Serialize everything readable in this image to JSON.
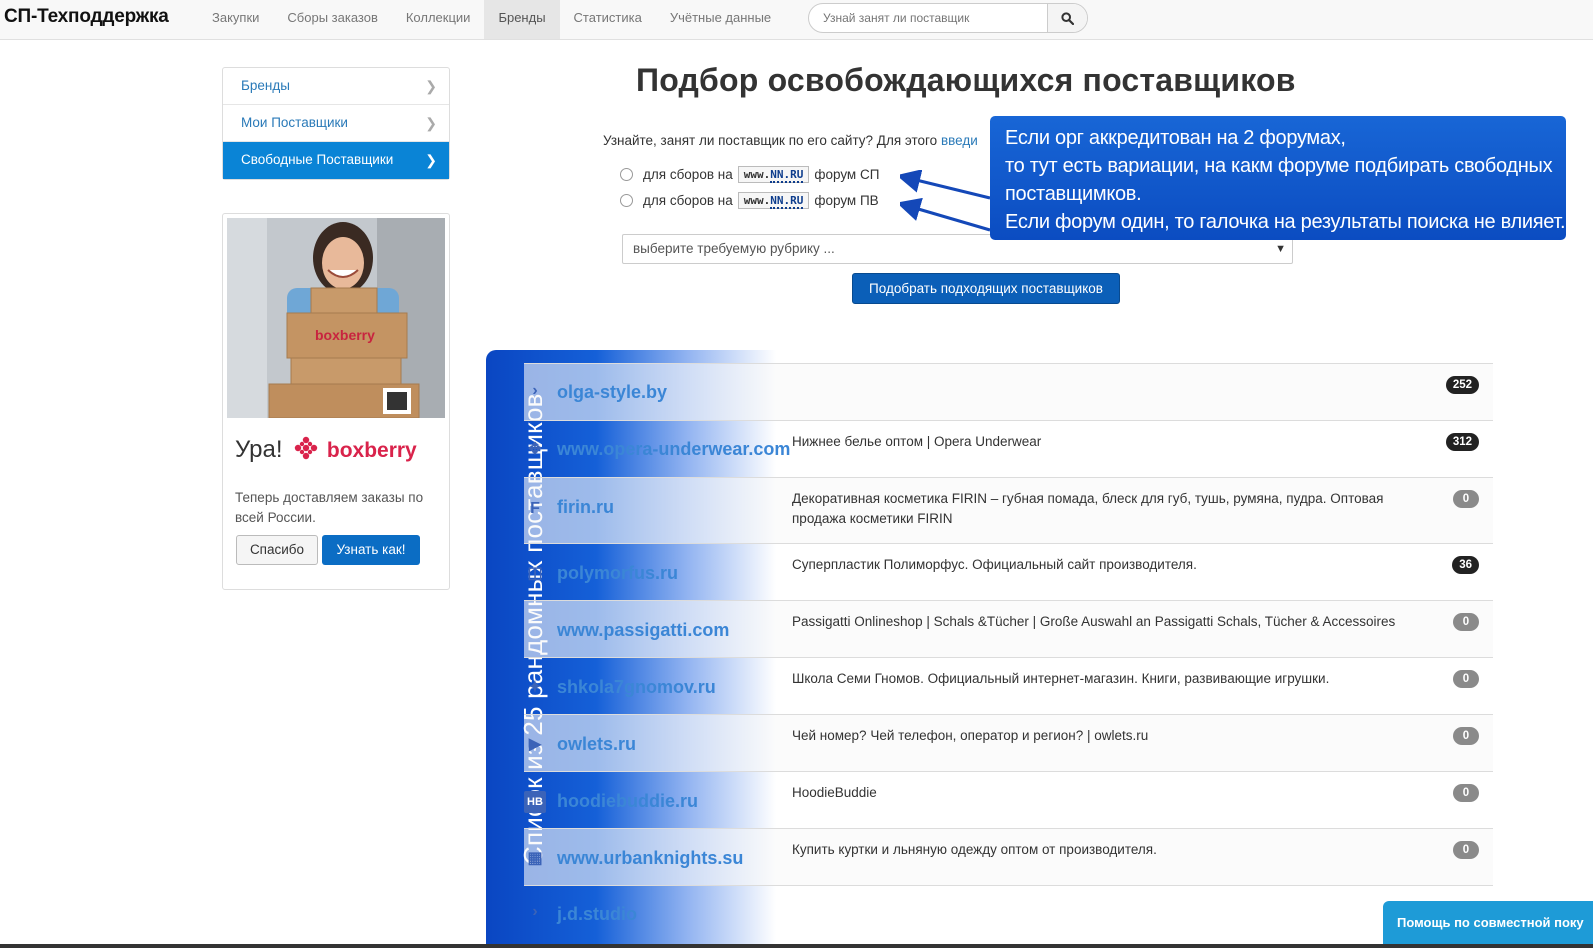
{
  "navbar": {
    "brand": "СП-Техподдержка",
    "items": [
      {
        "label": "Закупки"
      },
      {
        "label": "Сборы заказов"
      },
      {
        "label": "Коллекции"
      },
      {
        "label": "Бренды",
        "active": true
      },
      {
        "label": "Статистика"
      },
      {
        "label": "Учётные данные"
      }
    ],
    "search_placeholder": "Узнай занят ли поставщик",
    "search_icon": "search-icon"
  },
  "sidebar": {
    "items": [
      {
        "label": "Бренды"
      },
      {
        "label": "Мои Поставщики"
      },
      {
        "label": "Свободные Поставщики",
        "active": true
      }
    ]
  },
  "promo": {
    "title_prefix": "Ура!",
    "brand_name": "boxberry",
    "text": "Теперь доставляем заказы по всей России.",
    "thanks_button": "Спасибо",
    "learn_button": "Узнать как!"
  },
  "main": {
    "title": "Подбор освобождающихся поставщиков",
    "intro": "Узнайте, занят ли поставщик по его сайту? Для этого",
    "intro_link": "введи",
    "options": [
      {
        "prefix": "для сборов на",
        "logo_www": "www.",
        "logo_nn": "NN.RU",
        "suffix": "форум СП"
      },
      {
        "prefix": "для сборов на",
        "logo_www": "www.",
        "logo_nn": "NN.RU",
        "suffix": "форум ПВ"
      }
    ],
    "rubric_placeholder": "выберите требуемую рубрику ...",
    "find_button": "Подобрать подходящих поставщиков"
  },
  "callout": {
    "lines": [
      "Если орг аккредитован на 2 форумах,",
      "то тут есть вариации, на какм форуме подбирать свободных",
      "поставщимков.",
      "Если форум один, то галочка на результаты поиска не влияет."
    ]
  },
  "list": {
    "ribbon_label": "Список из 25 рандомных поставщиков",
    "rows": [
      {
        "icon": "chevron-right-icon",
        "site": "olga-style.by",
        "desc": "",
        "count": "252"
      },
      {
        "icon": "bird-icon",
        "site": "www.opera-underwear.com",
        "desc": "Нижнее белье оптом | Opera Underwear",
        "count": "312"
      },
      {
        "icon": "letter-f-icon",
        "site": "firin.ru",
        "desc": "Декоративная косметика FIRIN – губная помада, блеск для губ, тушь, румяна, пудра. Оптовая продажа косметики FIRIN",
        "count": "0"
      },
      {
        "icon": "cart-icon",
        "site": "polymorfus.ru",
        "desc": "Суперпластик Полиморфус. Официальный сайт производителя.",
        "count": "36"
      },
      {
        "icon": "blank-icon",
        "site": "www.passigatti.com",
        "desc": "Passigatti Onlineshop | Schals &Tücher | Große Auswahl an Passigatti Schals, Tücher & Accessoires",
        "count": "0"
      },
      {
        "icon": "gnome-icon",
        "site": "shkola7gnomov.ru",
        "desc": "Школа Семи Гномов. Официальный интернет-магазин. Книги, развивающие игрушки.",
        "count": "0"
      },
      {
        "icon": "play-icon",
        "site": "owlets.ru",
        "desc": "Чей номер? Чей телефон, оператор и регион? | owlets.ru",
        "count": "0"
      },
      {
        "icon": "hb-icon",
        "site": "hoodiebuddie.ru",
        "desc": "HoodieBuddie",
        "count": "0"
      },
      {
        "icon": "grid-icon",
        "site": "www.urbanknights.su",
        "desc": "Купить куртки и льняную одежду оптом от производителя.",
        "count": "0"
      },
      {
        "icon": "chevron-right-icon",
        "site": "j.d.studio",
        "desc": "",
        "count": ""
      }
    ]
  },
  "help_tab": "Помощь по совместной поку",
  "colors": {
    "accent": "#0a84d6",
    "callout": "#1060d0",
    "link": "#3b86d6",
    "help": "#1e9bd7"
  }
}
